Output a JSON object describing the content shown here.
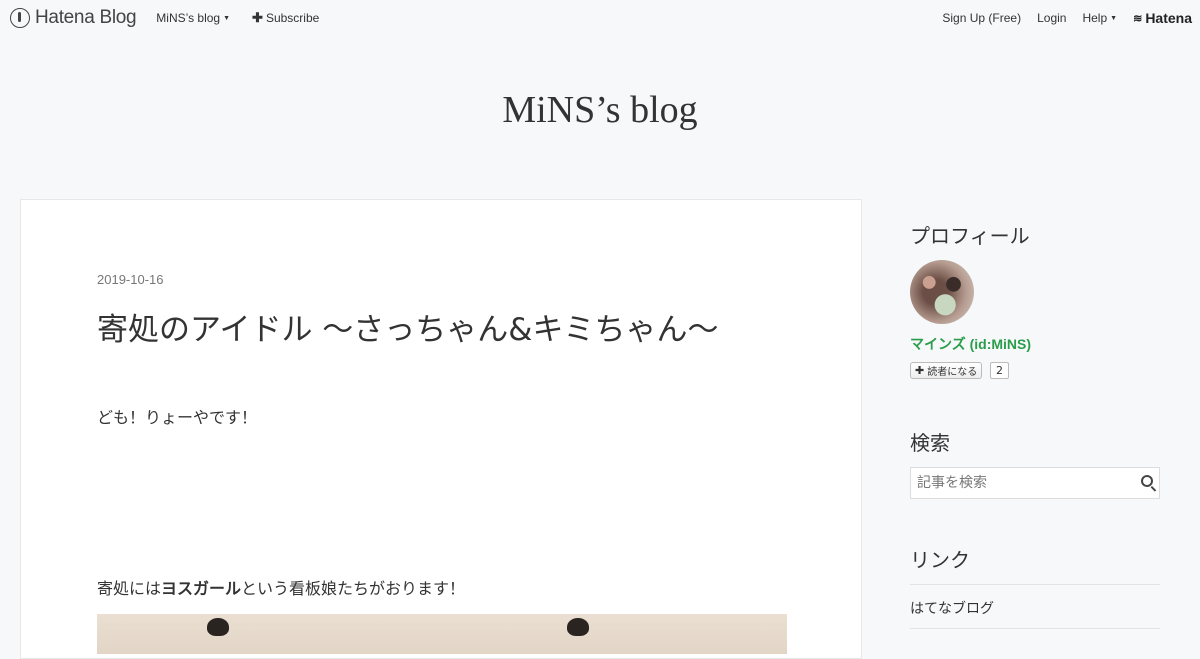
{
  "header": {
    "logo": "Hatena Blog",
    "blog_menu": "MiNS’s blog",
    "subscribe": "Subscribe",
    "signup": "Sign Up (Free)",
    "login": "Login",
    "help": "Help",
    "hatena": "Hatena"
  },
  "blog": {
    "title": "MiNS’s blog"
  },
  "entry": {
    "date": "2019-10-16",
    "title": "寄処のアイドル 〜さっちゃん&キミちゃん〜",
    "p1": "ども！りょーやです！",
    "p2_before": "寄処には",
    "p2_bold": "ヨスガール",
    "p2_after": "という看板娘たちがおります！"
  },
  "sidebar": {
    "profile_heading": "プロフィール",
    "profile_name": "マインズ (id:MiNS)",
    "subscribe_label": "読者になる",
    "subscriber_count": "2",
    "search_heading": "検索",
    "search_placeholder": "記事を検索",
    "links_heading": "リンク",
    "links": [
      "はてなブログ"
    ]
  },
  "icons": {
    "logo": "hatena-blog-logo-icon",
    "plus": "plus-icon",
    "caret": "caret-down-icon",
    "search": "search-icon"
  },
  "colors": {
    "background": "#f7f8fa",
    "profile_name": "#2a9d4b"
  }
}
